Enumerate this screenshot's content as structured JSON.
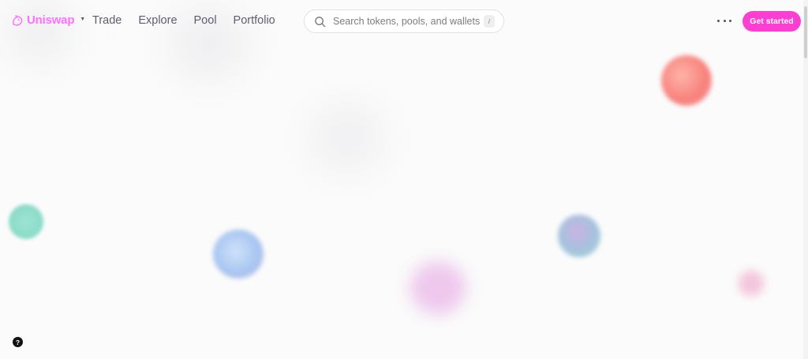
{
  "brand": {
    "name": "Uniswap",
    "color": "#fc72ff",
    "icon": "unicorn-icon"
  },
  "nav": {
    "links": [
      {
        "label": "Trade"
      },
      {
        "label": "Explore"
      },
      {
        "label": "Pool"
      },
      {
        "label": "Portfolio"
      }
    ]
  },
  "search": {
    "placeholder": "Search tokens, pools, and wallets",
    "shortcut": "/",
    "icon": "search-icon"
  },
  "actions": {
    "more_icon": "more-icon",
    "cta_label": "Get started",
    "cta_color": "#fc3ed2"
  },
  "help": {
    "label": "?"
  },
  "colors": {
    "background": "#fbfbfb",
    "nav_text": "#5e5e6e"
  }
}
